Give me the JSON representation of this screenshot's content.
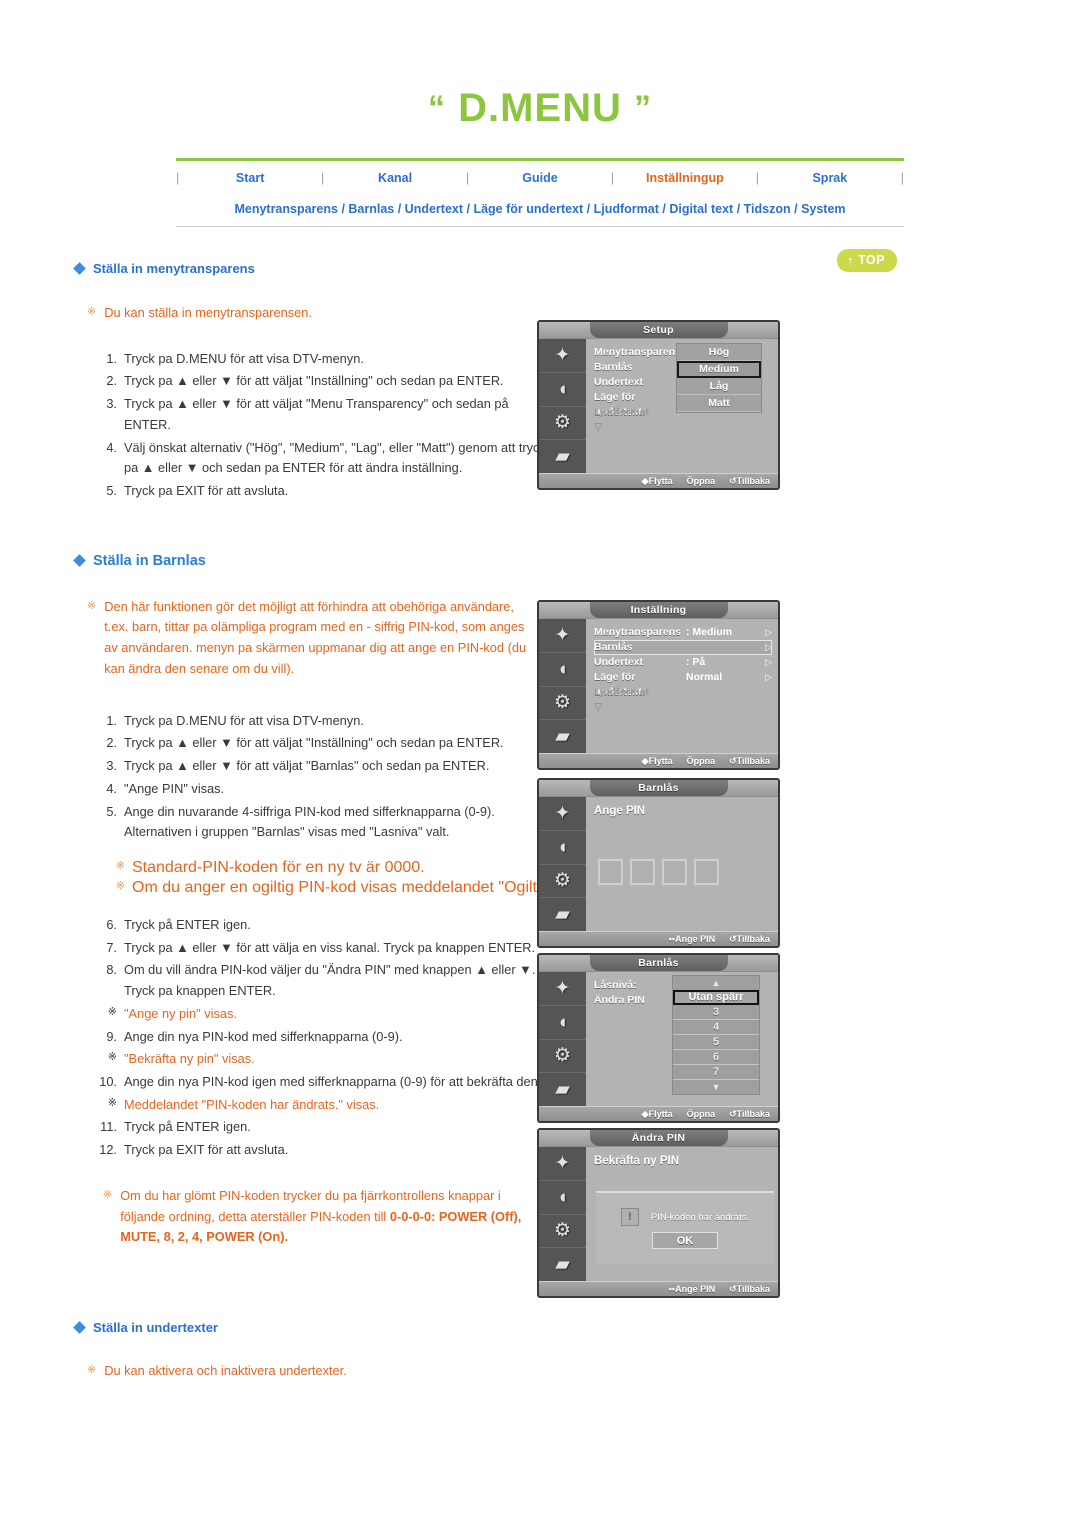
{
  "header": {
    "title_quote_open": "“",
    "title": "D.MENU",
    "title_quote_close": "”",
    "top_button": {
      "label": "TOP",
      "arrow": "↑"
    },
    "nav_items": [
      {
        "label": "Start",
        "active": false
      },
      {
        "label": "Kanal",
        "active": false
      },
      {
        "label": "Guide",
        "active": false
      },
      {
        "label": "Inställningup",
        "active": true
      },
      {
        "label": "Sprak",
        "active": false
      }
    ],
    "breadcrumbs": [
      "Menytransparens",
      "Barnlas",
      "Undertext",
      "Läge för undertext",
      "Ljudformat",
      "Digital text",
      "Tidszon",
      "System"
    ]
  },
  "section1": {
    "heading": "Ställa in menytransparens",
    "note": "Du kan ställa in menytransparensen.",
    "steps": [
      {
        "num": "1.",
        "text": "Tryck pa D.MENU för att visa DTV-menyn."
      },
      {
        "num": "2.",
        "text": "Tryck pa ▲ eller ▼ för att väljat \"Inställning\" och sedan pa ENTER."
      },
      {
        "num": "3.",
        "text": "Tryck pa ▲ eller ▼ för att väljat \"Menu Transparency\" och sedan på ENTER."
      },
      {
        "num": "4.",
        "text": "Välj önskat alternativ (\"Hög\", \"Medium\", \"Lag\", eller \"Matt\") genom att trycka pa ▲ eller ▼ och sedan pa ENTER för att ändra inställning."
      },
      {
        "num": "5.",
        "text": "Tryck pa EXIT för att avsluta."
      }
    ]
  },
  "section2": {
    "heading": "Ställa in Barnlas",
    "note": "Den här funktionen gör det möjligt att förhindra att obehöriga användare, t.ex. barn, tittar pa olämpliga program med en - siffrig PIN-kod, som anges av användaren. menyn pa skärmen uppmanar dig att ange en PIN-kod (du kan ändra den senare om du vill).",
    "steps": [
      {
        "num": "1.",
        "text": "Tryck pa D.MENU för att visa DTV-menyn."
      },
      {
        "num": "2.",
        "text": "Tryck pa ▲ eller ▼ för att väljat \"Inställning\" och sedan pa ENTER."
      },
      {
        "num": "3.",
        "text": "Tryck pa ▲ eller ▼ för att väljat \"Barnlas\" och sedan pa ENTER."
      },
      {
        "num": "4.",
        "text": "\"Ange PIN\" visas."
      },
      {
        "num": "5.",
        "text": "Ange din nuvarande 4-siffriga PIN-kod med sifferknapparna (0-9). Alternativen i gruppen \"Barnlas\" visas med \"Lasniva\" valt."
      }
    ],
    "notes_mid": [
      "Standard-PIN-koden för en ny tv är 0000.",
      "Om du anger en ogiltig PIN-kod visas meddelandet \"Ogiltig PIN-kod. Försök igen\"."
    ],
    "steps2": [
      {
        "type": "step",
        "num": "6.",
        "text": "Tryck på ENTER igen."
      },
      {
        "type": "step",
        "num": "7.",
        "text": "Tryck pa ▲ eller ▼ för att välja en viss kanal. Tryck pa knappen ENTER."
      },
      {
        "type": "step",
        "num": "8.",
        "text": "Om du vill ändra PIN-kod väljer du \"Ändra PIN\" med knappen ▲ eller ▼. Tryck pa knappen ENTER."
      },
      {
        "type": "note",
        "num": "※",
        "text": "\"Ange ny pin\" visas."
      },
      {
        "type": "step",
        "num": "9.",
        "text": "Ange din nya PIN-kod med sifferknapparna (0-9)."
      },
      {
        "type": "note",
        "num": "※",
        "text": "\"Bekräfta ny pin\" visas."
      },
      {
        "type": "step",
        "num": "10.",
        "text": "Ange din nya PIN-kod igen med sifferknapparna (0-9) för att bekräfta den."
      },
      {
        "type": "note",
        "num": "※",
        "text": "Meddelandet \"PIN-koden har ändrats.\" visas."
      },
      {
        "type": "step",
        "num": "11.",
        "text": "Tryck på ENTER igen."
      },
      {
        "type": "step",
        "num": "12.",
        "text": "Tryck pa EXIT för att avsluta."
      }
    ],
    "note_final_plain": "Om du har glömt PIN-koden trycker du pa fjärrkontrollens knappar i följande ordning, detta aterställer PIN-koden till ",
    "note_final_bold": "0-0-0-0: POWER (Off), MUTE, 8, 2, 4, POWER (On)."
  },
  "section3": {
    "heading": "Ställa in undertexter",
    "note": "Du kan aktivera och inaktivera undertexter."
  },
  "tv_screens": [
    {
      "title": "Setup",
      "rows": [
        {
          "label": "Menytransparens",
          "value": ":",
          "dim": false,
          "selected": false
        },
        {
          "label": "Barnlås",
          "value": ":",
          "dim": false,
          "selected": false
        },
        {
          "label": "Undertext",
          "value": ":",
          "dim": false,
          "selected": false
        },
        {
          "label": "Läge för undertext:",
          "value": "",
          "dim": false,
          "selected": false
        },
        {
          "label": "Ljudformat",
          "value": "",
          "dim": true,
          "selected": false
        },
        {
          "label": "▽",
          "value": "",
          "dim": true,
          "selected": false
        }
      ],
      "dropdown": {
        "options": [
          "Hög",
          "Medium",
          "Låg",
          "Matt"
        ],
        "selected": "Medium"
      },
      "footer": [
        "◆Flytta",
        "Öppna",
        "↺Tillbaka"
      ]
    },
    {
      "title": "Inställning",
      "rows": [
        {
          "label": "Menytransparens",
          "value": ": Medium",
          "dim": false,
          "selected": false,
          "caret": "▷"
        },
        {
          "label": "Barnlås",
          "value": "",
          "dim": false,
          "selected": true,
          "caret": "▷"
        },
        {
          "label": "Undertext",
          "value": ": På",
          "dim": false,
          "selected": false,
          "caret": "▷"
        },
        {
          "label": "Läge för undertext:",
          "value": "Normal",
          "dim": false,
          "selected": false,
          "caret": "▷"
        },
        {
          "label": "Ljudformat",
          "value": "",
          "dim": true,
          "selected": false,
          "caret": ""
        },
        {
          "label": "▽",
          "value": "",
          "dim": true,
          "selected": false,
          "caret": ""
        }
      ],
      "footer": [
        "◆Flytta",
        "Öppna",
        "↺Tillbaka"
      ]
    },
    {
      "title": "Barnlås",
      "prompt": "Ange PIN",
      "pin_boxes": 4,
      "footer": [
        "••Ange PIN",
        "↺Tillbaka"
      ]
    },
    {
      "title": "Barnlås",
      "rows": [
        {
          "label": "Låsnivå:",
          "value": "",
          "dim": false,
          "selected": false
        },
        {
          "label": "Ändra PIN",
          "value": "",
          "dim": false,
          "selected": false
        }
      ],
      "level_list": {
        "items": [
          "Utan spärr",
          "3",
          "4",
          "5",
          "6",
          "7"
        ],
        "selected": "Utan spärr",
        "up": "▲",
        "down": "▼"
      },
      "footer": [
        "◆Flytta",
        "Öppna",
        "↺Tillbaka"
      ]
    },
    {
      "title": "Ändra PIN",
      "prompt": "Bekräfta ny PIN",
      "dialog": {
        "message": "PIN-koden har ändrats.",
        "ok_label": "OK",
        "icon": "!"
      },
      "footer": [
        "••Ange PIN",
        "↺Tillbaka"
      ]
    }
  ]
}
